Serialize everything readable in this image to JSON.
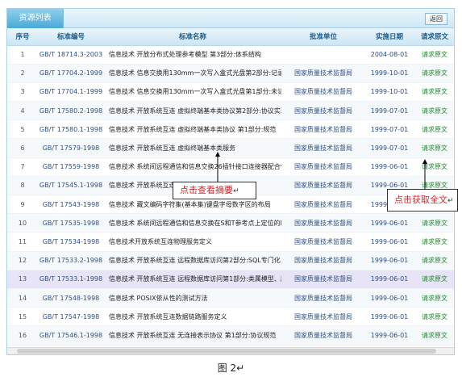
{
  "panel": {
    "tab_label": "资源列表",
    "back_label": "返回"
  },
  "columns": [
    "序号",
    "标准编号",
    "标准名称",
    "批准单位",
    "实施日期",
    "请求原文"
  ],
  "rows": [
    {
      "seq": "1",
      "std": "GB/T 18714.3-2003",
      "name": "信息技术 开放分布式处理参考模型 第3部分:体系结构",
      "org": "",
      "date": "2004-08-01",
      "req": "请求原文"
    },
    {
      "seq": "2",
      "std": "GB/T 17704.2-1999",
      "name": "信息技术 信息交换用130mm一次写入盒式光盘第2部分:记录",
      "org": "国家质量技术监督局",
      "date": "1999-10-01",
      "req": "请求原文"
    },
    {
      "seq": "3",
      "std": "GB/T 17704.1-1999",
      "name": "信息技术 信息交换用130mm一次写入盒式光盘第1部分:未记",
      "org": "国家质量技术监督局",
      "date": "1999-10-01",
      "req": "请求原文"
    },
    {
      "seq": "4",
      "std": "GB/T 17580.2-1998",
      "name": "信息技术 开放系统互连 虚拟终端基本类协议第2部分:协议实现",
      "org": "国家质量技术监督局",
      "date": "1999-07-01",
      "req": "请求原文"
    },
    {
      "seq": "5",
      "std": "GB/T 17580.1-1998",
      "name": "信息技术 开放系统互连 虚拟终端基本类协议 第1部分:规范",
      "org": "国家质量技术监督局",
      "date": "1999-07-01",
      "req": "请求原文"
    },
    {
      "seq": "6",
      "std": "GB/T 17579-1998",
      "name": "信息技术 开放系统互连 虚拟终端基本类服务",
      "org": "国家质量技术监督局",
      "date": "1999-07-01",
      "req": "请求原文"
    },
    {
      "seq": "7",
      "std": "GB/T 17559-1998",
      "name": "信息技术 系统间远程通信和信息交换26插针接口连接器配合性尺",
      "org": "国家质量技术监督局",
      "date": "1999-06-01",
      "req": "请求原文"
    },
    {
      "seq": "8",
      "std": "GB/T 17545.1-1998",
      "name": "信息技术 开放系统互连 ... 第1部",
      "org": "国家质量技术监督局",
      "date": "1999-06-01",
      "req": "请求原文"
    },
    {
      "seq": "9",
      "std": "GB/T 17543-1998",
      "name": "信息技术 藏文编码字符集(基本集)键盘字母数字区的布局",
      "org": "国家质量技术监督局",
      "date": "1999-06-01",
      "req": "请求原文"
    },
    {
      "seq": "10",
      "std": "GB/T 17535-1998",
      "name": "信息技术 系统间远程通信和信息交换在S和T参考点上定位的IS",
      "org": "国家质量技术监督局",
      "date": "1999-06-01",
      "req": "请求原文"
    },
    {
      "seq": "11",
      "std": "GB/T 17534-1998",
      "name": "信息技术开放系统互连物理服务定义",
      "org": "国家质量技术监督局",
      "date": "1999-06-01",
      "req": "请求原文"
    },
    {
      "seq": "12",
      "std": "GB/T 17533.2-1998",
      "name": "信息技术 开放系统互连 远程数据库访问第2部分:SQL专门化",
      "org": "国家质量技术监督局",
      "date": "1999-06-01",
      "req": "请求原文"
    },
    {
      "seq": "13",
      "std": "GB/T 17533.1-1998",
      "name": "信息技术 开放系统互连 远程数据库访问第1部分:类属模型、服",
      "org": "国家质量技术监督局",
      "date": "1999-06-01",
      "req": "请求原文"
    },
    {
      "seq": "14",
      "std": "GB/T 17548-1998",
      "name": "信息技术 POSIX依从性的测试方法",
      "org": "国家质量技术监督局",
      "date": "1999-06-01",
      "req": "请求原文"
    },
    {
      "seq": "15",
      "std": "GB/T 17547-1998",
      "name": "信息技术 开放系统互连数据链路服务定义",
      "org": "国家质量技术监督局",
      "date": "1999-06-01",
      "req": "请求原文"
    },
    {
      "seq": "16",
      "std": "GB/T 17546.1-1998",
      "name": "信息技术 开放系统互连 无连接表示协议 第1部分:协议规范",
      "org": "国家质量技术监督局",
      "date": "1999-06-01",
      "req": "请求原文"
    }
  ],
  "annotations": {
    "abstract": "点击查看摘要",
    "full_text": "点击获取全文",
    "return_mark": "↵"
  },
  "caption": "图 2↵"
}
